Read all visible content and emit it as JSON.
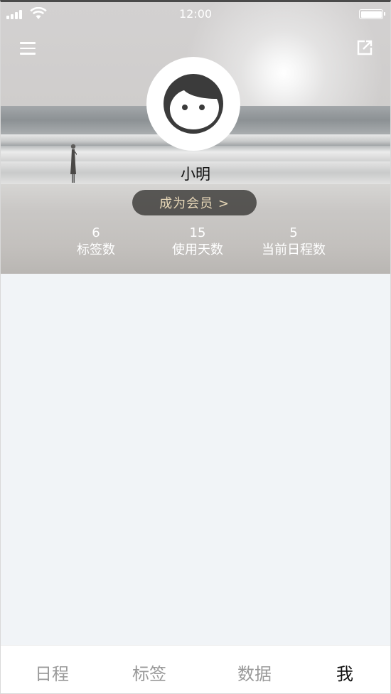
{
  "status_bar": {
    "time": "12:00",
    "icons": [
      "signal-icon",
      "wifi-icon",
      "battery-icon"
    ]
  },
  "header": {
    "menu_icon": "menu-icon",
    "share_icon": "share-icon"
  },
  "profile": {
    "avatar_icon": "face-avatar-icon",
    "username": "小明",
    "vip_button_label": "成为会员 >"
  },
  "stats": [
    {
      "value": "6",
      "label": "标签数"
    },
    {
      "value": "15",
      "label": "使用天数"
    },
    {
      "value": "5",
      "label": "当前日程数"
    }
  ],
  "tabbar": {
    "tabs": [
      {
        "label": "日程",
        "active": false
      },
      {
        "label": "标签",
        "active": false
      },
      {
        "label": "数据",
        "active": false
      },
      {
        "label": "我",
        "active": true
      }
    ]
  },
  "colors": {
    "vip_button_bg": "#3c3a38",
    "vip_button_text": "#e8d8b8",
    "content_bg": "#f1f4f7",
    "tab_active": "#111111",
    "tab_inactive": "#9a9a9a"
  }
}
